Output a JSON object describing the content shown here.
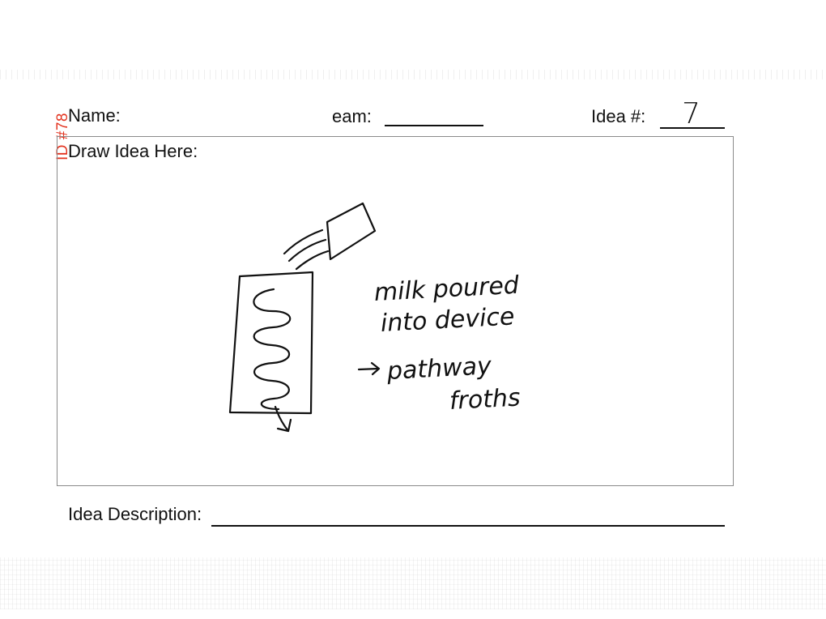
{
  "form": {
    "name_label": "Name:",
    "team_label": "eam:",
    "idea_label": "Idea #:",
    "idea_number": "7",
    "draw_label": "Draw Idea Here:",
    "description_label": "Idea Description:"
  },
  "stamp": {
    "id_text": "ID #78",
    "color": "#e3331f"
  },
  "sketch_notes": {
    "line1": "milk poured",
    "line2": "into device",
    "line3": "pathway",
    "line4": "froths"
  }
}
